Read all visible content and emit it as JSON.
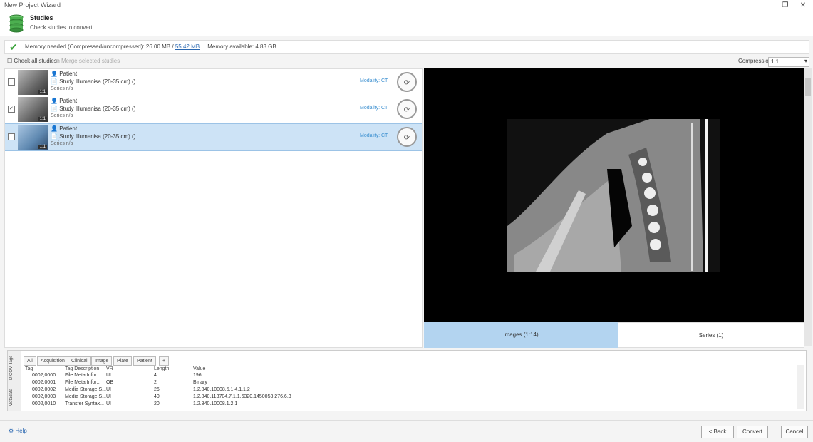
{
  "window": {
    "title": "New Project Wizard",
    "maximize_glyph": "❐",
    "close_glyph": "✕"
  },
  "header": {
    "title": "Studies",
    "subtitle": "Check studies to convert",
    "icon": "database-icon"
  },
  "memory": {
    "needed_label": "Memory needed (Compressed/uncompressed):",
    "needed_value_a": "26.00 MB",
    "separator": "/",
    "needed_value_b": "55.42 MB",
    "available_label": "Memory available:",
    "available_value": "4.83 GB"
  },
  "toolbar": {
    "check_all": "Check all studies",
    "merge": "Merge selected studies",
    "compression_label": "Compression",
    "compression_value": "1:1"
  },
  "studies": [
    {
      "patient": "Patient",
      "study": "Study Illumenisa (20-35 cm) ()",
      "series": "Series n/a",
      "modality": "Modality: CT",
      "badge": "1:1",
      "selected": false,
      "checked": false
    },
    {
      "patient": "Patient",
      "study": "Study Illumenisa (20-35 cm) ()",
      "series": "Series n/a",
      "modality": "Modality: CT",
      "badge": "1:1",
      "selected": false,
      "checked": true
    },
    {
      "patient": "Patient",
      "study": "Study Illumenisa (20-35 cm) ()",
      "series": "Series n/a",
      "modality": "Modality: CT",
      "badge": "1:1",
      "selected": true,
      "checked": false
    }
  ],
  "preview_tabs": {
    "images": "Images (1:14)",
    "series": "Series (1)"
  },
  "tags": {
    "side_tabs": [
      "DICOM Tags",
      "Metadata"
    ],
    "filter_tabs": [
      "All",
      "Acquisition",
      "Clinical",
      "Image",
      "Plate",
      "Patient",
      "+"
    ],
    "columns": [
      "Tag",
      "Tag Description",
      "VR",
      "Length",
      "Value"
    ],
    "rows": [
      [
        "0002,0000",
        "File Meta Infor...",
        "UL",
        "4",
        "196"
      ],
      [
        "0002,0001",
        "File Meta Infor...",
        "OB",
        "2",
        "Binary"
      ],
      [
        "0002,0002",
        "Media Storage S...",
        "UI",
        "26",
        "1.2.840.10008.5.1.4.1.1.2"
      ],
      [
        "0002,0003",
        "Media Storage S...",
        "UI",
        "40",
        "1.2.840.113704.7.1.1.6320.1450053.276.6.3"
      ],
      [
        "0002,0010",
        "Transfer Syntax...",
        "UI",
        "20",
        "1.2.840.10008.1.2.1"
      ]
    ]
  },
  "footer": {
    "help": "Help",
    "back": "< Back",
    "convert": "Convert",
    "cancel": "Cancel"
  },
  "colors": {
    "accent": "#3a8fd0",
    "selection": "#cde3f6",
    "check": "#3aa23a",
    "tab_active": "#b3d4f0"
  }
}
